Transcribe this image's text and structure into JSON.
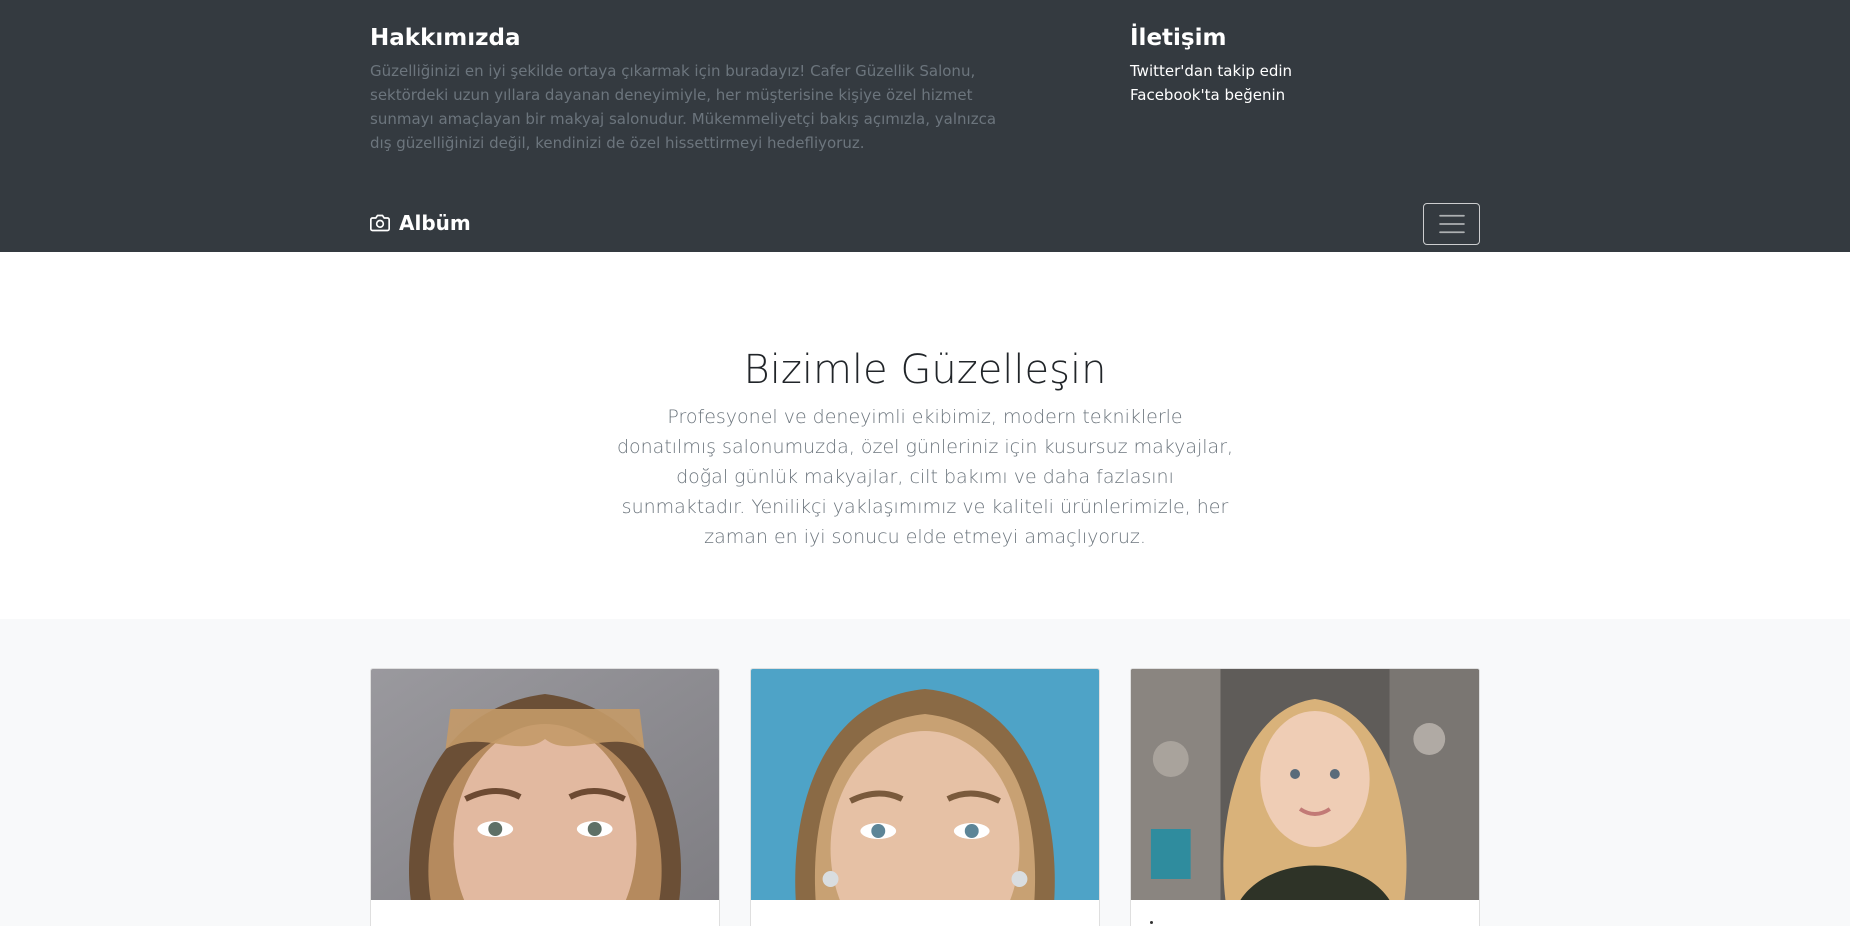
{
  "header": {
    "about_title": "Hakkımızda",
    "about_text": "Güzelliğinizi en iyi şekilde ortaya çıkarmak için buradayız! Cafer Güzellik Salonu, sektördeki uzun yıllara dayanan deneyimiyle, her müşterisine kişiye özel hizmet sunmayı amaçlayan bir makyaj salonudur. Mükemmeliyetçi bakış açımızla, yalnızca dış güzelliğinizi değil, kendinizi de özel hissettirmeyi hedefliyoruz.",
    "contact_title": "İletişim",
    "contact_links": [
      {
        "label": "Twitter'dan takip edin"
      },
      {
        "label": "Facebook'ta beğenin"
      }
    ]
  },
  "navbar": {
    "brand": "Albüm",
    "brand_icon": "camera-icon",
    "toggler_icon": "menu-icon"
  },
  "jumbotron": {
    "heading": "Bizimle Güzelleşin",
    "lead": "Profesyonel ve deneyimli ekibimiz, modern tekniklerle donatılmış salonumuzda, özel günleriniz için kusursuz makyajlar, doğal günlük makyajlar, cilt bakımı ve daha fazlasını sunmaktadır. Yenilikçi yaklaşımımız ve kaliteli ürünlerimizle, her zaman en iyi sonucu elde etmeyi amaçlıyoruz."
  },
  "album": {
    "cards": [
      {
        "image": "portrait-photo-1",
        "bg": "#8f8e93"
      },
      {
        "image": "portrait-photo-2",
        "bg": "#4ea3c7"
      },
      {
        "image": "portrait-photo-3",
        "bg": "#6d6a66"
      }
    ]
  },
  "colors": {
    "dark": "#343a40",
    "muted": "#6c757d",
    "light_bg": "#f8f9fa"
  }
}
